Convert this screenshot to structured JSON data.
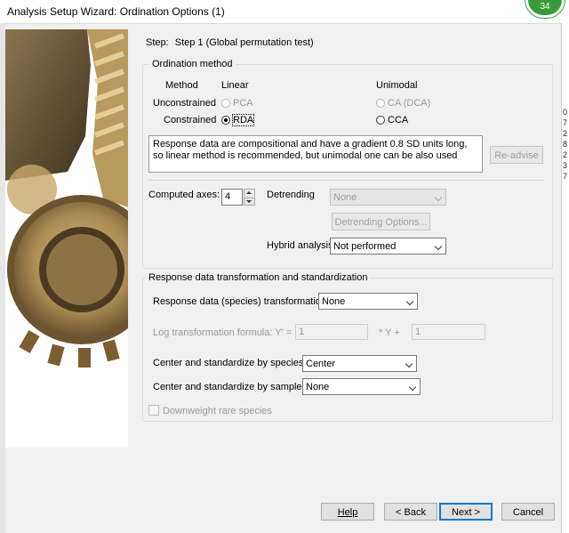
{
  "window": {
    "title": "Analysis Setup Wizard: Ordination Options (1)",
    "badge": "34"
  },
  "right_edge_numbers": [
    "0",
    "7",
    "2",
    "8",
    "2",
    "3",
    "7"
  ],
  "step": {
    "prefix": "Step:",
    "value": "Step 1 (Global permutation test)"
  },
  "ordination": {
    "group_title": "Ordination method",
    "method_header": "Method",
    "linear_header": "Linear",
    "unimodal_header": "Unimodal",
    "unconstrained_label": "Unconstrained",
    "constrained_label": "Constrained",
    "pca": "PCA",
    "rda": "RDA",
    "ca": "CA (DCA)",
    "cca": "CCA",
    "selected": "RDA",
    "advice_text": "Response data are compositional and have a gradient 0.8 SD units long, so linear method is recommended, but unimodal one can be also used",
    "readvise_label": "Re-advise"
  },
  "axes": {
    "label": "Computed axes:",
    "value": "4"
  },
  "detrending": {
    "label": "Detrending",
    "value": "None",
    "options_button": "Detrending Options..."
  },
  "hybrid": {
    "label": "Hybrid analysis",
    "value": "Not performed"
  },
  "transform": {
    "group_title": "Response data transformation and standardization",
    "species_label": "Response data (species) transformation",
    "species_value": "None",
    "log_label": "Log transformation formula: Y' =",
    "log_a": "1",
    "log_mid": "* Y +",
    "log_b": "1",
    "center_species_label": "Center and standardize by species",
    "center_species_value": "Center",
    "center_samples_label": "Center and standardize by samples",
    "center_samples_value": "None",
    "downweight_label": "Downweight rare species"
  },
  "buttons": {
    "help": "Help",
    "back": "< Back",
    "next": "Next >",
    "cancel": "Cancel"
  }
}
